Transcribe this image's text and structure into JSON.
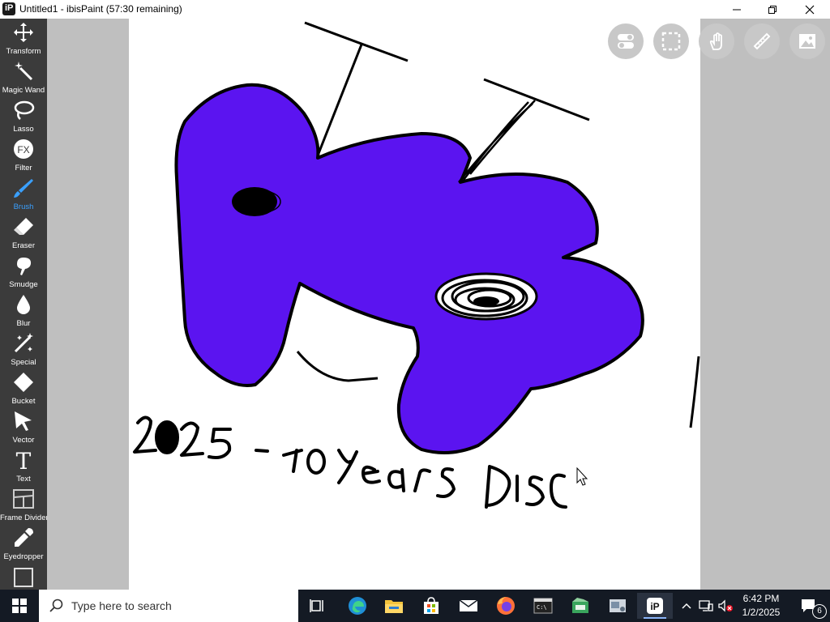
{
  "window": {
    "title": "Untitled1 - ibisPaint (57:30 remaining)",
    "app_icon_glyph": "iP"
  },
  "tools": [
    {
      "label": "Transform",
      "icon": "move-arrows-icon"
    },
    {
      "label": "Magic Wand",
      "icon": "magic-wand-icon"
    },
    {
      "label": "Lasso",
      "icon": "lasso-icon"
    },
    {
      "label": "Filter",
      "icon": "fx-icon",
      "glyph": "FX"
    },
    {
      "label": "Brush",
      "icon": "brush-icon",
      "active": true
    },
    {
      "label": "Eraser",
      "icon": "eraser-icon"
    },
    {
      "label": "Smudge",
      "icon": "smudge-icon"
    },
    {
      "label": "Blur",
      "icon": "drop-icon"
    },
    {
      "label": "Special",
      "icon": "special-icon"
    },
    {
      "label": "Bucket",
      "icon": "bucket-icon"
    },
    {
      "label": "Vector",
      "icon": "cursor-icon"
    },
    {
      "label": "Text",
      "icon": "text-icon",
      "glyph": "T"
    },
    {
      "label": "Frame Divider",
      "icon": "frame-divider-icon"
    },
    {
      "label": "Eyedropper",
      "icon": "eyedropper-icon"
    }
  ],
  "top_buttons": [
    "toggle-icon",
    "selection-icon",
    "hand-icon",
    "ruler-icon",
    "image-icon"
  ],
  "canvas": {
    "drawing_text": "2025 - 10 years DISC",
    "fill_color": "#5b14f0"
  },
  "taskbar": {
    "search_placeholder": "Type here to search",
    "time": "6:42 PM",
    "date": "1/2/2025",
    "notification_count": "6",
    "accent": "#8ab4f8"
  }
}
